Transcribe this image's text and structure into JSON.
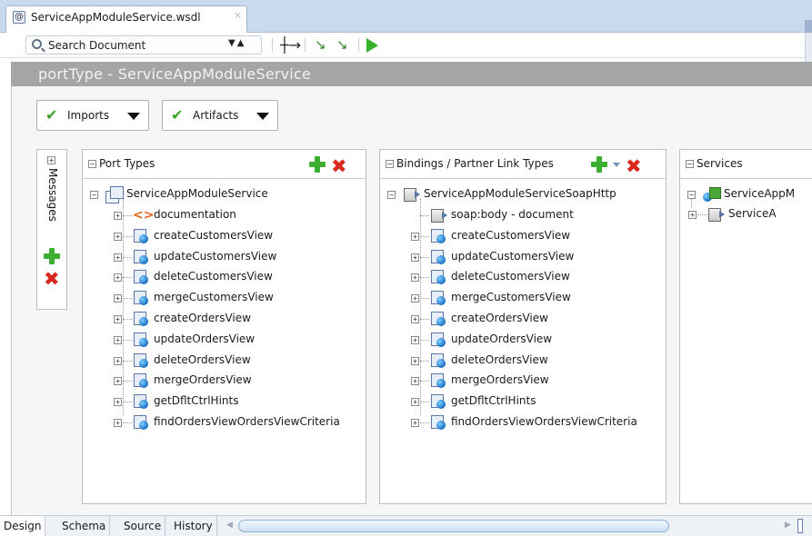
{
  "document_tab": {
    "title": "ServiceAppModuleService.wsdl",
    "icon": "wsdl-file-icon",
    "close_icon": "close-icon"
  },
  "toolbar": {
    "search_placeholder": "Search Document",
    "icons": [
      "search-icon",
      "search-nav-arrows-icon",
      "expand-icon",
      "link-icon",
      "unlink-icon",
      "run-icon"
    ]
  },
  "title_bar": {
    "text": "portType - ServiceAppModuleService"
  },
  "menu_buttons": [
    {
      "label": "Imports",
      "icon": "checkmark-icon"
    },
    {
      "label": "Artifacts",
      "icon": "checkmark-icon"
    }
  ],
  "messages_panel": {
    "label": "Messages"
  },
  "port_types": {
    "header": "Port Types",
    "root": "ServiceAppModuleService",
    "items": [
      {
        "label": "documentation",
        "icon": "documentation-icon"
      },
      {
        "label": "createCustomersView",
        "icon": "operation-icon"
      },
      {
        "label": "updateCustomersView",
        "icon": "operation-icon"
      },
      {
        "label": "deleteCustomersView",
        "icon": "operation-icon"
      },
      {
        "label": "mergeCustomersView",
        "icon": "operation-icon"
      },
      {
        "label": "createOrdersView",
        "icon": "operation-icon"
      },
      {
        "label": "updateOrdersView",
        "icon": "operation-icon"
      },
      {
        "label": "deleteOrdersView",
        "icon": "operation-icon"
      },
      {
        "label": "mergeOrdersView",
        "icon": "operation-icon"
      },
      {
        "label": "getDfltCtrlHints",
        "icon": "operation-icon"
      },
      {
        "label": "findOrdersViewOrdersViewCriteria",
        "icon": "operation-icon"
      }
    ]
  },
  "bindings": {
    "header": "Bindings / Partner Link Types",
    "root": "ServiceAppModuleServiceSoapHttp",
    "items": [
      {
        "label": "soap:body - document",
        "icon": "binding-icon"
      },
      {
        "label": "createCustomersView",
        "icon": "operation-icon"
      },
      {
        "label": "updateCustomersView",
        "icon": "operation-icon"
      },
      {
        "label": "deleteCustomersView",
        "icon": "operation-icon"
      },
      {
        "label": "mergeCustomersView",
        "icon": "operation-icon"
      },
      {
        "label": "createOrdersView",
        "icon": "operation-icon"
      },
      {
        "label": "updateOrdersView",
        "icon": "operation-icon"
      },
      {
        "label": "deleteOrdersView",
        "icon": "operation-icon"
      },
      {
        "label": "mergeOrdersView",
        "icon": "operation-icon"
      },
      {
        "label": "getDfltCtrlHints",
        "icon": "operation-icon"
      },
      {
        "label": "findOrdersViewOrdersViewCriteria",
        "icon": "operation-icon"
      }
    ]
  },
  "services": {
    "header": "Services",
    "root": "ServiceAppM",
    "child": "ServiceA"
  },
  "bottom_tabs": [
    "Design",
    "Schema",
    "Source",
    "History"
  ],
  "colors": {
    "title_bar": "#a5a5a5",
    "add_green": "#3cae2f",
    "delete_red": "#d9281d",
    "tab_strip": "#c9d9ee"
  }
}
